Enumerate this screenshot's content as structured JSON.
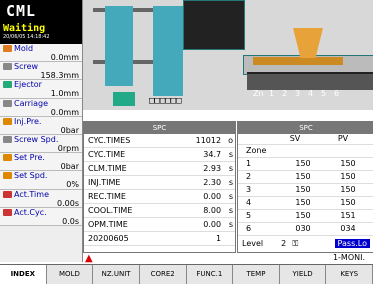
{
  "brand": "CML",
  "status": {
    "state": "Waiting",
    "datetime": "20/06/05 14:18:42"
  },
  "sidebar": [
    {
      "label": "Mold",
      "value": "0.0mm",
      "color": "#e07a22"
    },
    {
      "label": "Screw",
      "value": "158.3mm",
      "color": "#888"
    },
    {
      "label": "Ejector",
      "value": "1.0mm",
      "color": "#2a7"
    },
    {
      "label": "Carriage",
      "value": "0.0mm",
      "color": "#888"
    },
    {
      "label": "Inj.Pre.",
      "value": "0bar",
      "color": "#d80"
    },
    {
      "label": "Screw Spd.",
      "value": "0rpm",
      "color": "#888"
    },
    {
      "label": "Set Pre.",
      "value": "0bar",
      "color": "#d80"
    },
    {
      "label": "Set Spd.",
      "value": "0%",
      "color": "#d80"
    },
    {
      "label": "Act.Time",
      "value": "0.00s",
      "color": "#c33"
    },
    {
      "label": "Act.Cyc.",
      "value": "0.0s",
      "color": "#c33"
    }
  ],
  "machine": {
    "zone_label": "Zn",
    "zones": [
      "1",
      "2",
      "3",
      "4",
      "5",
      "6"
    ],
    "indicator": "□□□□□□"
  },
  "spc_left": {
    "title": "SPC",
    "rows": [
      {
        "k": "CYC.TIMES",
        "v": "11012",
        "u": "o"
      },
      {
        "k": "CYC.TIME",
        "v": "34.7",
        "u": "s"
      },
      {
        "k": "CLM.TIME",
        "v": "2.93",
        "u": "s"
      },
      {
        "k": "INJ.TIME",
        "v": "2.30",
        "u": "s"
      },
      {
        "k": "REC.TIME",
        "v": "0.00",
        "u": "s"
      },
      {
        "k": "COOL.TIME",
        "v": "8.00",
        "u": "s"
      },
      {
        "k": "OPM.TIME",
        "v": "0.00",
        "u": "s"
      },
      {
        "k": "20200605",
        "v": "1",
        "u": ""
      }
    ]
  },
  "spc_right": {
    "title": "SPC",
    "headers": [
      "",
      "SV",
      "PV"
    ],
    "rows": [
      {
        "zone": "Zone",
        "sv": "",
        "pv": ""
      },
      {
        "zone": "1",
        "sv": "150",
        "pv": "150"
      },
      {
        "zone": "2",
        "sv": "150",
        "pv": "150"
      },
      {
        "zone": "3",
        "sv": "150",
        "pv": "150"
      },
      {
        "zone": "4",
        "sv": "150",
        "pv": "150"
      },
      {
        "zone": "5",
        "sv": "150",
        "pv": "151"
      },
      {
        "zone": "6",
        "sv": "030",
        "pv": "034"
      }
    ],
    "level_label": "Level",
    "level_value": "2",
    "pass_label": "Pass.Lo"
  },
  "monitor_label": "1-MONI.",
  "tabs": [
    "INDEX",
    "MOLD",
    "NZ.UNIT",
    "CORE2",
    "FUNC.1",
    "TEMP",
    "YIELD",
    "KEYS"
  ]
}
